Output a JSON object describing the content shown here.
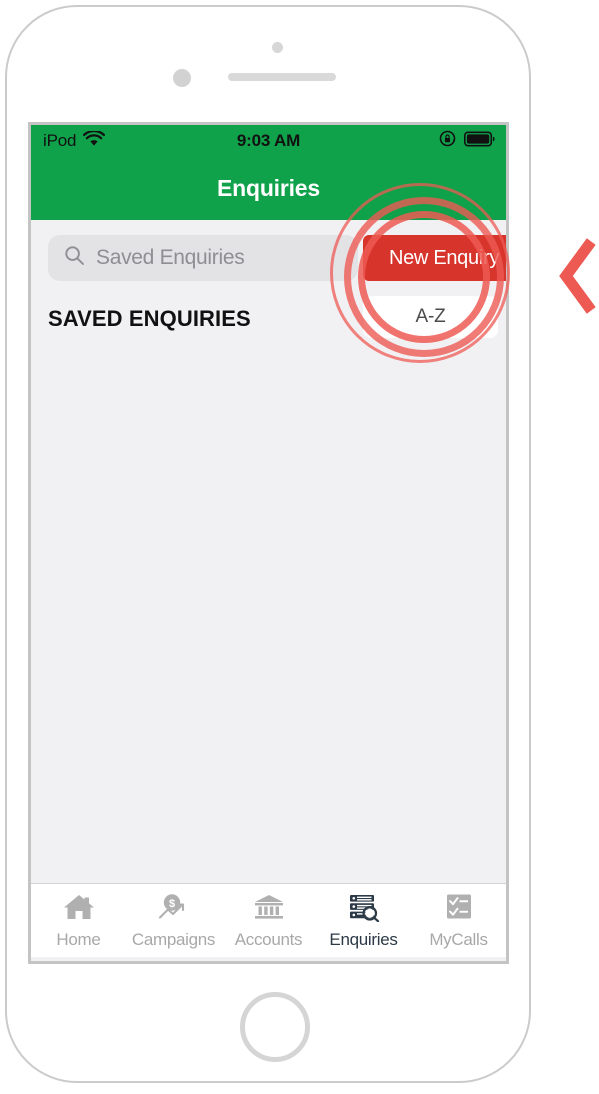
{
  "device": {
    "name": "ipod-touch-frame",
    "sensor_icon": "proximity-sensor",
    "camera_icon": "front-camera",
    "speaker_icon": "earpiece-speaker",
    "home_button_icon": "home-button"
  },
  "status_bar": {
    "carrier": "iPod",
    "wifi_icon": "wifi-icon",
    "time": "9:03 AM",
    "rotation_lock_icon": "rotation-lock-icon",
    "battery_icon": "battery-icon",
    "background_color": "#10A24A"
  },
  "nav_bar": {
    "title": "Enquiries",
    "background_color": "#10A24A",
    "title_color": "#FFFFFF"
  },
  "search": {
    "icon": "search-icon",
    "placeholder": "Saved Enquiries",
    "value": ""
  },
  "actions": {
    "new_enquiry_label": "New Enquiry",
    "new_enquiry_color": "#D7342C"
  },
  "list": {
    "section_header": "SAVED ENQUIRIES",
    "sort_label": "A-Z",
    "items": []
  },
  "tab_bar": {
    "active_index": 3,
    "active_color": "#2C3A47",
    "inactive_color": "#A8A8A8",
    "tabs": [
      {
        "label": "Home",
        "icon": "home-icon"
      },
      {
        "label": "Campaigns",
        "icon": "campaigns-dollar-chart-icon"
      },
      {
        "label": "Accounts",
        "icon": "accounts-bank-icon"
      },
      {
        "label": "Enquiries",
        "icon": "enquiries-list-search-icon"
      },
      {
        "label": "MyCalls",
        "icon": "mycalls-checklist-icon"
      }
    ]
  },
  "annotation": {
    "highlight_target": "New Enquiry",
    "ring_color": "#ED5A54",
    "pointer_icon": "chevron-left-icon",
    "ring_count": 3
  }
}
